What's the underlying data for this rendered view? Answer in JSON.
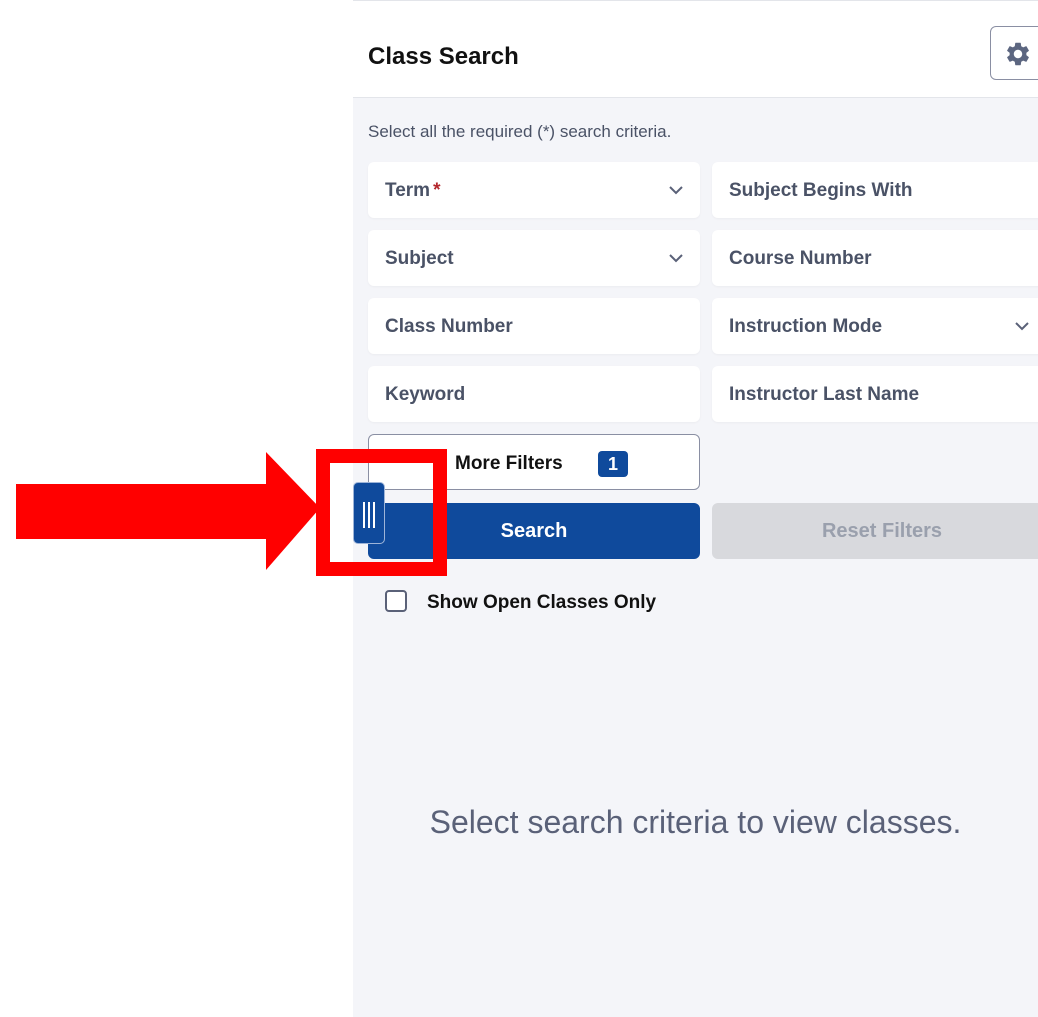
{
  "header": {
    "title": "Class Search",
    "settings_icon": "gear-icon"
  },
  "form": {
    "instructions": "Select all the required (*) search criteria.",
    "required_marker": "*",
    "fields": {
      "term": {
        "label": "Term",
        "type": "dropdown"
      },
      "subject_begins_with": {
        "label": "Subject Begins With",
        "type": "text"
      },
      "subject": {
        "label": "Subject",
        "type": "dropdown"
      },
      "course_number": {
        "label": "Course Number",
        "type": "text"
      },
      "class_number": {
        "label": "Class Number",
        "type": "text"
      },
      "instruction_mode": {
        "label": "Instruction Mode",
        "type": "dropdown"
      },
      "keyword": {
        "label": "Keyword",
        "type": "text"
      },
      "instructor_last_name": {
        "label": "Instructor Last Name",
        "type": "text"
      }
    },
    "more_filters": {
      "label": "More Filters",
      "count": "1"
    },
    "search_button": "Search",
    "reset_button": "Reset Filters",
    "open_classes_checkbox": {
      "label": "Show Open Classes Only",
      "checked": false
    }
  },
  "results": {
    "empty_message": "Select search criteria to view classes."
  },
  "colors": {
    "primary": "#0f4a9c",
    "panel_background": "#f4f5f9",
    "required": "#b3262b",
    "annotation": "#ff0000"
  }
}
